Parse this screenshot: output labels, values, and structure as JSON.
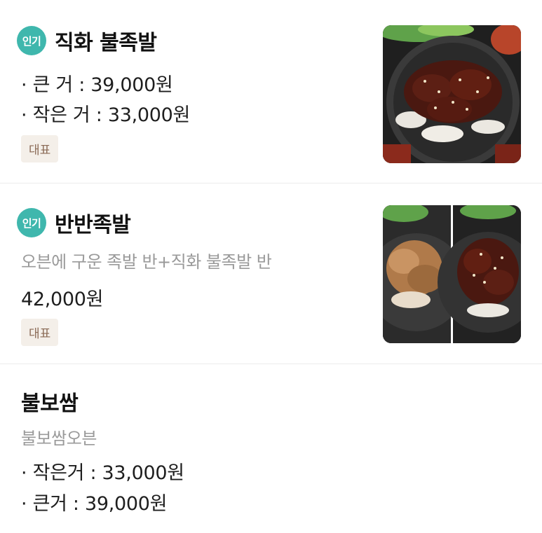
{
  "menu": [
    {
      "badge": "인기",
      "name": "직화 불족발",
      "prices": [
        "· 큰 거 : 39,000원",
        "· 작은 거 : 33,000원"
      ],
      "tag": "대표",
      "image_icon": "food-photo"
    },
    {
      "badge": "인기",
      "name": "반반족발",
      "description": "오븐에 구운 족발 반+직화 불족발 반",
      "price": "42,000원",
      "tag": "대표",
      "image_icon": "food-photo"
    },
    {
      "name": "불보쌈",
      "description": "불보쌈오븐",
      "prices": [
        "· 작은거 : 33,000원",
        "· 큰거 : 39,000원"
      ]
    }
  ],
  "colors": {
    "popular_badge": "#3fb7ad",
    "tag_bg": "#f4efe9",
    "tag_text": "#8a6a55",
    "description": "#9a9a9a"
  }
}
